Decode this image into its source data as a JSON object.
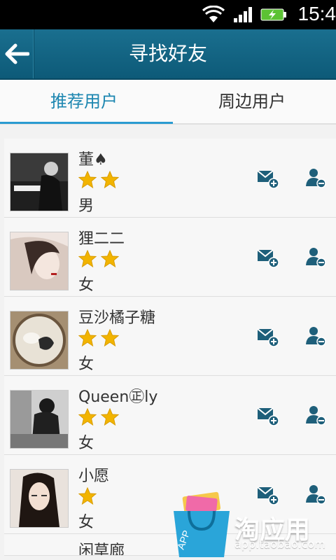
{
  "status": {
    "time": "15:4"
  },
  "header": {
    "title": "寻找好友"
  },
  "tabs": [
    {
      "label": "推荐用户",
      "active": true
    },
    {
      "label": "周边用户",
      "active": false
    }
  ],
  "users": [
    {
      "name": "董♠",
      "stars": 2,
      "gender": "男"
    },
    {
      "name": "狸二二",
      "stars": 2,
      "gender": "女"
    },
    {
      "name": "豆沙橘子糖",
      "stars": 2,
      "gender": "女"
    },
    {
      "name": "Queen㊣ly",
      "stars": 2,
      "gender": "女"
    },
    {
      "name": "小愿",
      "stars": 1,
      "gender": "女"
    },
    {
      "name": "闲草廊",
      "stars": 0,
      "gender": ""
    }
  ],
  "watermark": {
    "brand": "淘应用",
    "url": "app.taobao.com",
    "badge": "APP",
    "accent": "#2aa5d9"
  },
  "colors": {
    "accent": "#1c86b0",
    "titlebar": "#0d5a78",
    "icon": "#1e5f7a",
    "star": "#f2b400"
  }
}
